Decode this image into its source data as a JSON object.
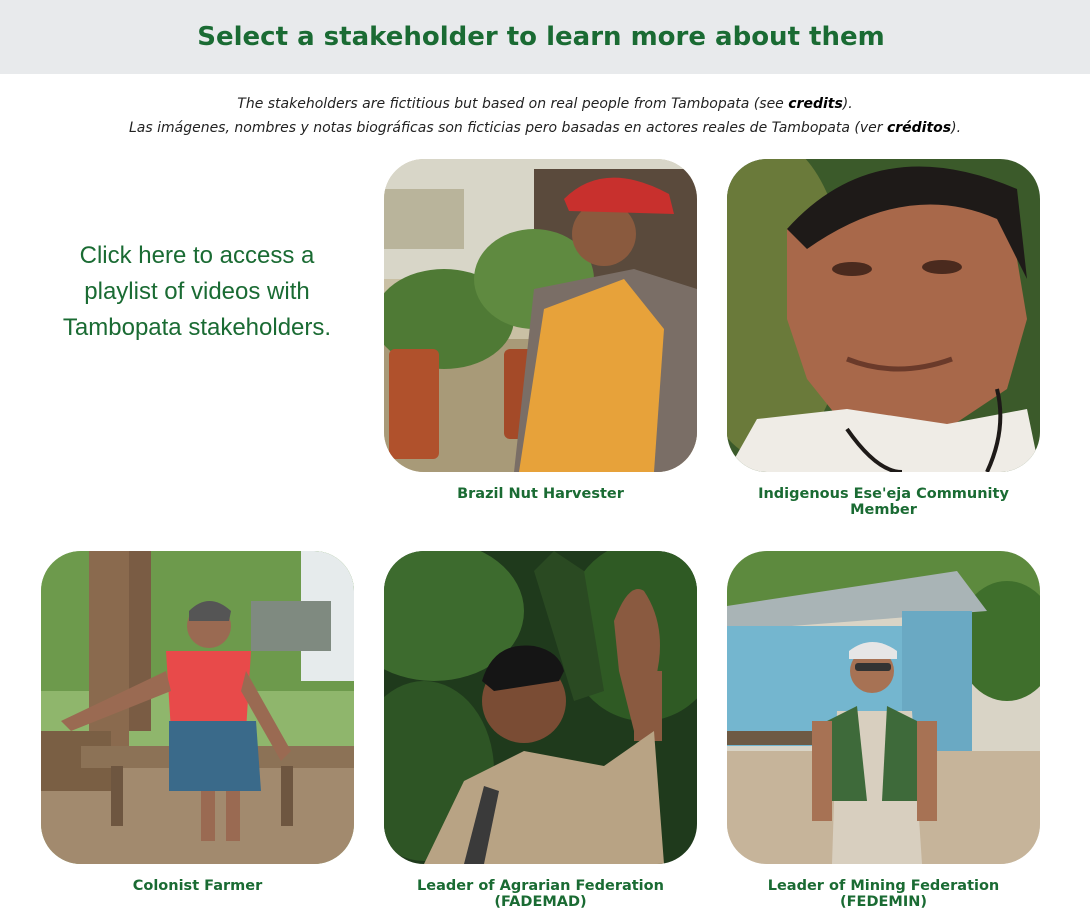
{
  "header": {
    "title": "Select a stakeholder to learn more about them"
  },
  "note": {
    "en_prefix": "The stakeholders are fictitious but based on real people from Tambopata (see ",
    "en_link": "credits",
    "en_suffix": ").",
    "es_prefix": "Las imágenes, nombres y notas biográficas son ficticias pero basadas en actores reales de Tambopata (ver ",
    "es_link": "créditos",
    "es_suffix": ")."
  },
  "playlist": {
    "label": "Click here to access a playlist of videos with Tambopata stakeholders."
  },
  "stakeholders": [
    {
      "caption": "Brazil Nut Harvester",
      "icon": "harvester-photo"
    },
    {
      "caption": "Indigenous Ese'eja Community Member",
      "icon": "community-member-photo"
    },
    {
      "caption": "Colonist Farmer",
      "icon": "farmer-photo"
    },
    {
      "caption": "Leader of Agrarian Federation (FADEMAD)",
      "icon": "fademad-leader-photo"
    },
    {
      "caption": "Leader of Mining Federation (FEDEMIN)",
      "icon": "fedemin-leader-photo"
    }
  ],
  "colors": {
    "accent": "#1a6b33",
    "header_bg": "#e8eaec"
  }
}
